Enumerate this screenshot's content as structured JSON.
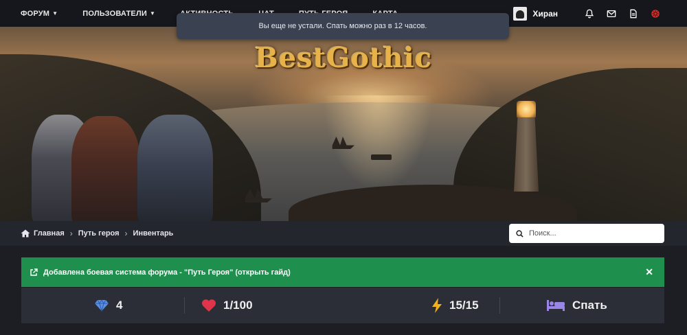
{
  "nav": {
    "items": [
      {
        "label": "Форум",
        "has_dropdown": true
      },
      {
        "label": "Пользователи",
        "has_dropdown": true
      },
      {
        "label": "Активность",
        "has_dropdown": false
      },
      {
        "label": "Чат",
        "has_dropdown": false
      },
      {
        "label": "Путь героя",
        "has_dropdown": false
      },
      {
        "label": "Карта",
        "has_dropdown": false
      }
    ],
    "user_name": "Хиран",
    "icons": [
      "bell-icon",
      "envelope-icon",
      "document-icon",
      "settings-gear-icon"
    ],
    "accent_icon_color": "#e0312f"
  },
  "toast": {
    "message": "Вы еще не устали. Спать можно раз в 12 часов."
  },
  "banner": {
    "logo_text": "BestGothic"
  },
  "breadcrumb": {
    "items": [
      "Главная",
      "Путь героя",
      "Инвентарь"
    ]
  },
  "search": {
    "placeholder": "Поиск..."
  },
  "notice": {
    "text": "Добавлена боевая система форума - \"Путь Героя\" (открыть гайд)",
    "color": "#1f8f4e"
  },
  "stats": {
    "gems": "4",
    "health": "1/100",
    "energy": "15/15",
    "sleep_label": "Спать",
    "colors": {
      "gem": "#5b8fe0",
      "heart": "#e0344a",
      "bolt": "#f2b21c",
      "bed": "#9a86e8"
    }
  }
}
